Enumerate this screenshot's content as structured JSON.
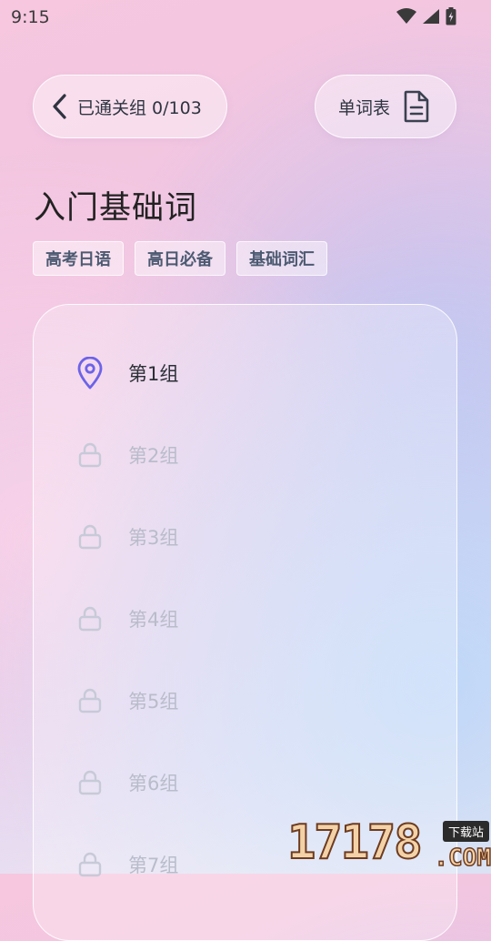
{
  "status": {
    "time": "9:15"
  },
  "header": {
    "back_label": "已通关组 0/103",
    "wordlist_label": "单词表"
  },
  "title": "入门基础词",
  "tags": [
    "高考日语",
    "高日必备",
    "基础词汇"
  ],
  "groups": [
    {
      "label": "第1组",
      "state": "current"
    },
    {
      "label": "第2组",
      "state": "locked"
    },
    {
      "label": "第3组",
      "state": "locked"
    },
    {
      "label": "第4组",
      "state": "locked"
    },
    {
      "label": "第5组",
      "state": "locked"
    },
    {
      "label": "第6组",
      "state": "locked"
    },
    {
      "label": "第7组",
      "state": "locked"
    }
  ],
  "watermark": {
    "digits": "17178",
    "badge": "下载站",
    "suffix": ".COM"
  },
  "colors": {
    "accent": "#6c63e8",
    "locked": "#c7cad8",
    "tag_text": "#4c5a72"
  }
}
